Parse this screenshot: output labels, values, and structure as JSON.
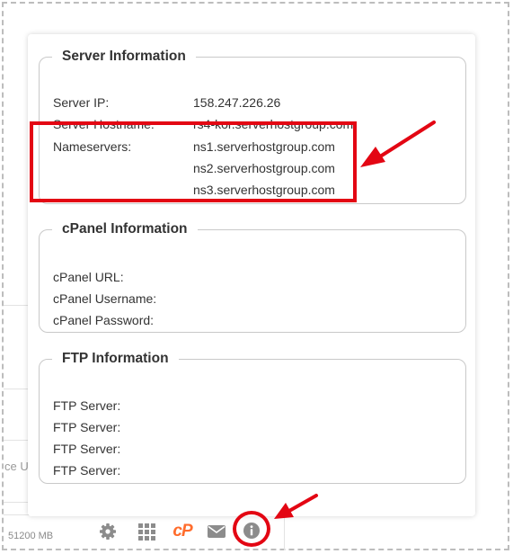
{
  "background": {
    "partial_text": "ce U",
    "disk_size": "51200 MB"
  },
  "server_info": {
    "title": "Server Information",
    "ip_label": "Server IP:",
    "ip_value": "158.247.226.26",
    "hostname_label": "Server Hostname:",
    "hostname_value": "rs4-kor.serverhostgroup.com",
    "nameservers_label": "Nameservers:",
    "nameservers": [
      "ns1.serverhostgroup.com",
      "ns2.serverhostgroup.com",
      "ns3.serverhostgroup.com"
    ]
  },
  "cpanel_info": {
    "title": "cPanel Information",
    "url_label": "cPanel URL:",
    "username_label": "cPanel Username:",
    "password_label": "cPanel Password:"
  },
  "ftp_info": {
    "title": "FTP Information",
    "labels": [
      "FTP Server:",
      "FTP Server:",
      "FTP Server:",
      "FTP Server:"
    ]
  },
  "toolbar": {
    "icons": [
      "gear-icon",
      "grid-icon",
      "cpanel-icon",
      "mail-icon",
      "info-icon"
    ],
    "cpanel_text": "cP"
  },
  "colors": {
    "annotation_red": "#e30613",
    "icon_gray": "#8c8c8c"
  }
}
